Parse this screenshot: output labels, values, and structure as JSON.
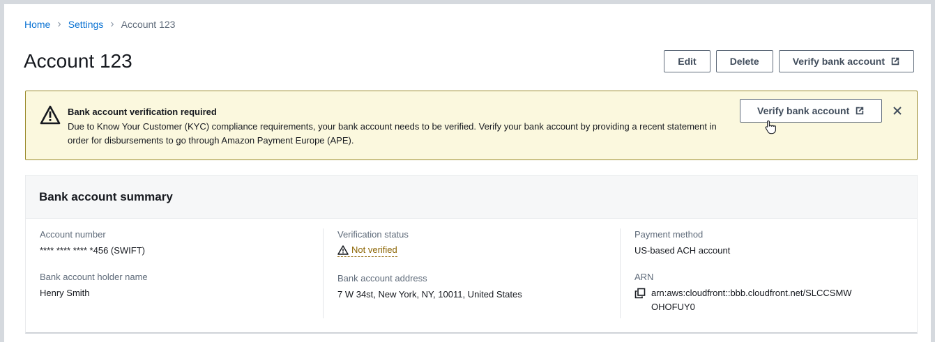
{
  "breadcrumb": {
    "items": [
      "Home",
      "Settings"
    ],
    "current": "Account 123"
  },
  "page": {
    "title": "Account 123",
    "actions": {
      "edit": "Edit",
      "delete": "Delete",
      "verify": "Verify bank account"
    }
  },
  "alert": {
    "title": "Bank account verification required",
    "body": "Due to Know Your Customer (KYC)  compliance requirements, your bank account needs to be verified. Verify your bank account by providing a recent statement in order for disbursements to go through Amazon Payment Europe (APE).",
    "action": "Verify bank account",
    "type_color": "#9a8a2b"
  },
  "summary": {
    "title": "Bank account summary",
    "account_number_label": "Account number",
    "account_number": "**** **** **** *456 (SWIFT)",
    "holder_label": "Bank account holder name",
    "holder": "Henry Smith",
    "status_label": "Verification status",
    "status": "Not verified",
    "address_label": "Bank account address",
    "address": "7 W 34st, New York, NY, 10011, United States",
    "payment_label": "Payment method",
    "payment": "US-based ACH account",
    "arn_label": "ARN",
    "arn": "arn:aws:cloudfront::bbb.cloudfront.net/SLCCSMWOHOFUY0"
  },
  "colors": {
    "link": "#0972d3",
    "warning_bg": "#fbf8de",
    "warning_text": "#8d6605"
  }
}
